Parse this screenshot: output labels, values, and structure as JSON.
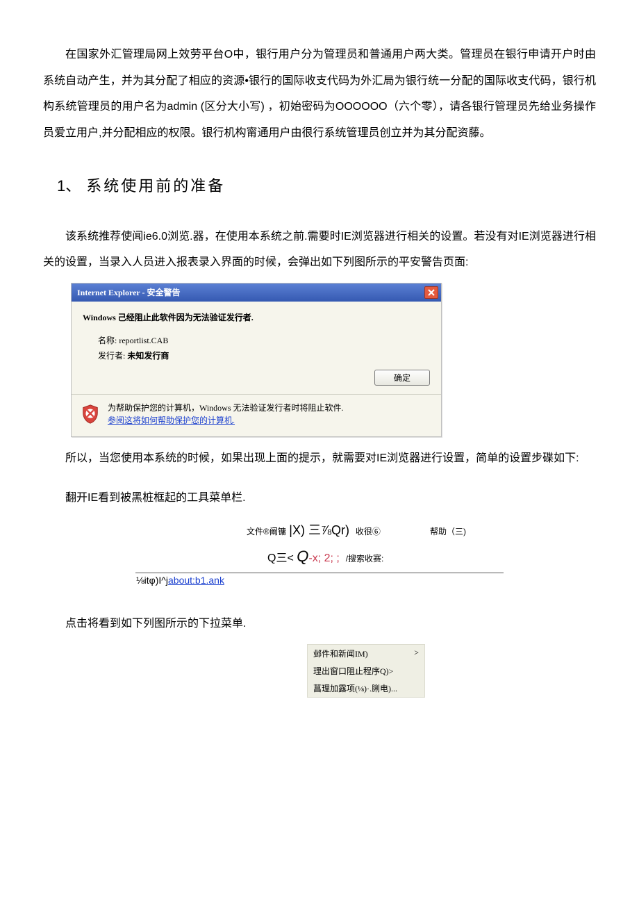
{
  "intro": "在国家外汇管理局网上效劳平台O中，银行用户分为管理员和普通用户两大类。管理员在银行申请开户时由系统自动产生，并为其分配了相应的资源•银行的国际收支代码为外汇局为银行统一分配的国际收支代码，银行机构系统管理员的用户名为admin (区分大小写) ，初始密码为OOOOOO（六个零），请各银行管理员先给业务操作员爱立用户,并分配相应的权限。银行机构甯通用户由很行系统管理员创立并为其分配资藤。",
  "h1_num": "1、",
  "h1_text": "系统使用前的准备",
  "p2": "该系统推荐使闻ie6.0浏览.器，在使用本系统之前.需要时IE浏览器进行相关的设置。若没有对IE浏览器进行相关的设置，当录入人员进入报表录入界面的时候，会弹出如下列图所示的平安警告页面:",
  "dlg": {
    "title": "Internet Explorer - 安全警告",
    "line1": "Windows 己经阻止此软件因为无法验证发行者.",
    "name_label": "名称:",
    "name_value": "reportlist.CAB",
    "pub_label": "发行者:",
    "pub_value": "未知发行商",
    "ok": "确定",
    "foot_text": "为帮助保护您的计算机，Windows 无法验证发行者时将阻止软件.",
    "foot_link": "参阅这将如何帮助保护您的计算机."
  },
  "p3": "所以，当您使用本系统的时候，如果出现上面的提示，就需要对IE浏览器进行设置，简单的设置步碟如下:",
  "p4": "翻开IE看到被黑桩框起的工具菜单栏.",
  "iebar": {
    "row1_a": "文件®阚镛",
    "row1_b": "|X)  三⅞Qr)",
    "row1_c": "收很⑥",
    "row1_help": "帮助（三)",
    "row2_a": "Q三<",
    "row2_b": "Q",
    "row2_c": "-x;  2;  ;",
    "row2_d": "/搜索收赛:",
    "addr_a": "⅛itφ)I^j",
    "addr_b": "about:b1.ank"
  },
  "p5": "点击将看到如下列图所示的下拉菜单.",
  "menu": {
    "m1": "邺件和新闻IM)",
    "m1a": ">",
    "m2": "理出窗口阻止程序Q)>",
    "m3": "菖理加露项(⅛)·.脷电)..."
  }
}
